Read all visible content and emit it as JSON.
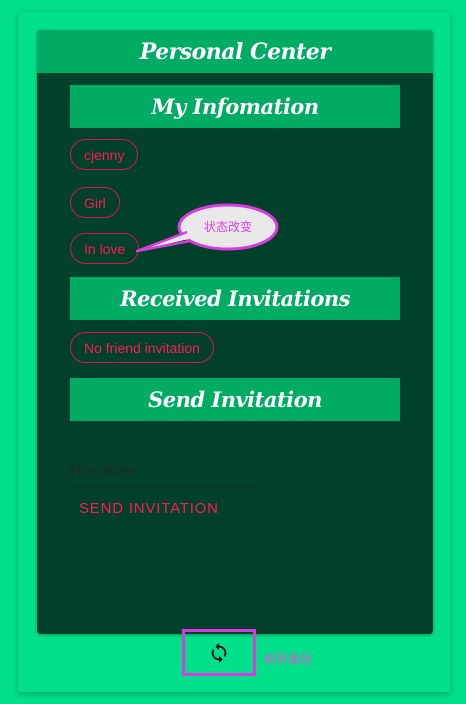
{
  "header": {
    "title": "Personal Center"
  },
  "my_information": {
    "title": "My Infomation",
    "username": "cjenny",
    "gender": "Girl",
    "status": "In love"
  },
  "status_bubble": {
    "text": "状态改变"
  },
  "received_invitations": {
    "title": "Received Invitations",
    "empty_text": "No friend invitation"
  },
  "send_invitation": {
    "title": "Send Invitation",
    "receiver_placeholder": "Receiver",
    "receiver_value": "",
    "send_label": "SEND INVITATION"
  },
  "refresh": {
    "icon": "refresh-icon",
    "label": "刷页面后"
  },
  "colors": {
    "background": "#00e08a",
    "card": "#01402a",
    "section_bar": "#00ac64",
    "accent": "#ff1a56",
    "annotation": "#d83ce0"
  }
}
